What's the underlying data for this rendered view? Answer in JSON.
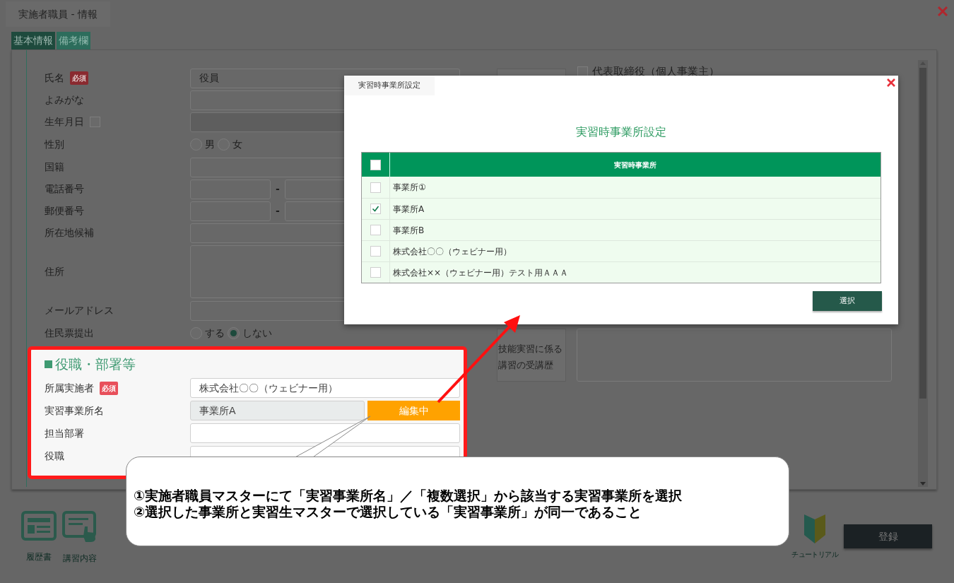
{
  "window": {
    "title": "実施者職員 - 情報"
  },
  "tabs": [
    {
      "label": "基本情報",
      "selected": true
    },
    {
      "label": "備考欄",
      "selected": false
    }
  ],
  "form": {
    "fields": [
      {
        "kind": "text",
        "label": "氏名",
        "badge": "必須",
        "value": "役員"
      },
      {
        "kind": "text",
        "label": "よみがな"
      },
      {
        "kind": "date",
        "label": "生年月日",
        "checked": false
      },
      {
        "kind": "radio",
        "label": "性別",
        "options": [
          {
            "label": "男",
            "selected": false
          },
          {
            "label": "女",
            "selected": false
          }
        ]
      },
      {
        "kind": "text",
        "label": "国籍"
      },
      {
        "kind": "split",
        "label": "電話番号",
        "separator": "-"
      },
      {
        "kind": "split",
        "label": "郵便番号",
        "separator": "-"
      },
      {
        "kind": "text",
        "label": "所在地候補"
      },
      {
        "kind": "area",
        "label": "住所"
      },
      {
        "kind": "text",
        "label": "メールアドレス"
      },
      {
        "kind": "radio",
        "label": "住民票提出",
        "options": [
          {
            "label": "する",
            "selected": false
          },
          {
            "label": "しない",
            "selected": true
          }
        ]
      }
    ]
  },
  "right_column": {
    "representative": {
      "label": "代表取締役（個人事業主）",
      "checked": false
    },
    "history_label": "技能実習に係る講習の受講歴"
  },
  "position_section": {
    "title": "役職・部署等",
    "fields": [
      {
        "kind": "text",
        "label": "所属実施者",
        "badge": "必須",
        "value": "株式会社〇〇（ウェビナー用）"
      },
      {
        "kind": "picker",
        "label": "実習事業所名",
        "value": "事業所A",
        "button": "編集中"
      },
      {
        "kind": "text",
        "label": "担当部署"
      },
      {
        "kind": "text",
        "label": "役職"
      }
    ]
  },
  "footer": {
    "links": [
      {
        "label": "履歴書",
        "kind": "resume"
      },
      {
        "label": "講習内容",
        "kind": "lecture"
      }
    ],
    "tutorial": "チュートリアル",
    "register": "登録"
  },
  "modal": {
    "tab": "実習時事業所設定",
    "heading": "実習時事業所設定",
    "select_all_checked": false,
    "column": "実習時事業所",
    "rows": [
      {
        "name": "事業所①",
        "checked": false
      },
      {
        "name": "事業所A",
        "checked": true
      },
      {
        "name": "事業所B",
        "checked": false
      },
      {
        "name": "株式会社〇〇（ウェビナー用）",
        "checked": false
      },
      {
        "name": "株式会社××（ウェビナー用）テスト用ＡＡＡ",
        "checked": false
      }
    ],
    "button": "選択"
  },
  "callout": {
    "lines": [
      "①実施者職員マスターにて「実習事業所名」／「複数選択」から該当する実習事業所を選択",
      "②選択した事業所と実習生マスターで選択している「実習事業所」が同一であること"
    ]
  }
}
